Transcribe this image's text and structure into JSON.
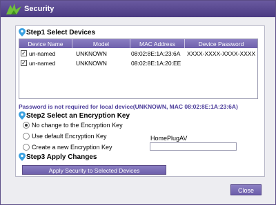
{
  "window": {
    "title": "Security"
  },
  "step1": {
    "title": "Step1 Select Devices"
  },
  "table": {
    "columns": [
      "Device Name",
      "Model",
      "MAC Address",
      "Device Password"
    ],
    "rows": [
      {
        "checked": true,
        "name": "un-named",
        "model": "UNKNOWN",
        "mac": "08:02:8E:1A:23:6A",
        "password": "XXXX-XXXX-XXXX-XXXX"
      },
      {
        "checked": true,
        "name": "un-named",
        "model": "UNKNOWN",
        "mac": "08:02:8E:1A:20:EE",
        "password": ""
      }
    ]
  },
  "note": "Password is not required for local device(UNKNOWN, MAC 08:02:8E:1A:23:6A)",
  "step2": {
    "title": "Step2 Select an Encryption Key",
    "options": [
      {
        "label": "No change to the Encryption Key",
        "selected": true
      },
      {
        "label": "Use default Encryption Key",
        "selected": false
      },
      {
        "label": "Create a new Encryption Key",
        "selected": false
      }
    ],
    "default_key": "HomePlugAV",
    "new_key_value": ""
  },
  "step3": {
    "title": "Step3 Apply Changes",
    "apply_label": "Apply Security to Selected Devices"
  },
  "footer": {
    "close_label": "Close"
  },
  "colors": {
    "accent": "#6d5fab",
    "titlebar": "#4a3a82",
    "note": "#4b3c9a",
    "pin": "#3aa0e0"
  }
}
